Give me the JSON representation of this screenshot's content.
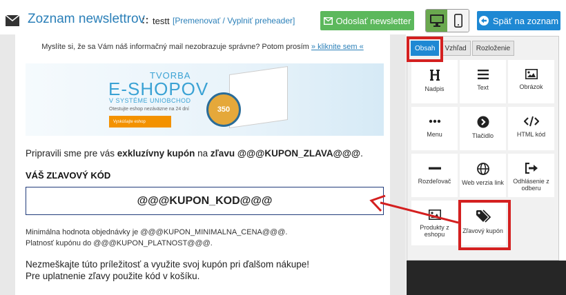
{
  "header": {
    "title": "Zoznam newslettrov",
    "separator": "::",
    "newsletter_name": "testt",
    "rename_link": "[Premenovať / Vyplniť preheader]",
    "send_button": "Odoslať newsletter",
    "back_button": "Späť na zoznam",
    "view_desktop_icon": "desktop-icon",
    "view_mobile_icon": "mobile-icon"
  },
  "email": {
    "notice_text": "Myslíte si, že sa Vám náš informačný mail nezobrazuje správne? Potom prosím",
    "notice_link": "» kliknite sem «",
    "banner": {
      "line1": "TVORBA",
      "line2": "E-SHOPOV",
      "line3": "V SYSTÉME UNIOBCHOD",
      "line4": "Otestujte eshop nezáväzne na 24 dní",
      "button": "Vyskúšajte eshop",
      "badge": "350"
    },
    "coupon_intro_1": "Pripravili sme pre vás ",
    "coupon_intro_bold1": "exkluzívny kupón",
    "coupon_intro_2": " na ",
    "coupon_intro_bold2": "zľavu @@@KUPON_ZLAVA@@@",
    "coupon_intro_3": ".",
    "code_heading": "VÁŠ ZĽAVOVÝ KÓD",
    "code_value": "@@@KUPON_KOD@@@",
    "min_line1": "Minimálna hodnota objednávky je @@@KUPON_MINIMALNA_CENA@@@.",
    "min_line2": "Platnosť kupónu do @@@KUPON_PLATNOST@@@.",
    "footer_line1": "Nezmeškajte túto príležitosť a využite svoj kupón pri ďalšom nákupe!",
    "footer_line2": "Pre uplatnenie zľavy použite kód v košíku."
  },
  "panel": {
    "tabs": [
      {
        "label": "Obsah",
        "active": true
      },
      {
        "label": "Vzhľad",
        "active": false
      },
      {
        "label": "Rozloženie",
        "active": false
      }
    ],
    "blocks": [
      {
        "label": "Nadpis",
        "icon": "heading-icon"
      },
      {
        "label": "Text",
        "icon": "text-lines-icon"
      },
      {
        "label": "Obrázok",
        "icon": "image-icon"
      },
      {
        "label": "Menu",
        "icon": "menu-dots-icon"
      },
      {
        "label": "Tlačidlo",
        "icon": "button-chevron-icon"
      },
      {
        "label": "HTML kód",
        "icon": "code-icon"
      },
      {
        "label": "Rozdeľovač",
        "icon": "divider-icon"
      },
      {
        "label": "Web verzia link",
        "icon": "globe-icon"
      },
      {
        "label": "Odhlásenie z odberu",
        "icon": "sign-out-icon"
      },
      {
        "label": "Produkty z eshopu",
        "icon": "products-image-icon"
      },
      {
        "label": "Zľavový kupón",
        "icon": "tags-icon"
      }
    ]
  },
  "colors": {
    "accent_blue": "#1e88d3",
    "send_green": "#5cb85c",
    "highlight_red": "#d42020",
    "link_blue": "#2a7fb8"
  }
}
